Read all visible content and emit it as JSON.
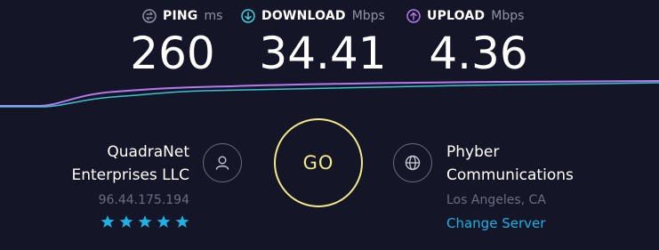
{
  "metrics": {
    "ping": {
      "label": "PING",
      "unit": "ms",
      "value": "260",
      "icon": "ping-icon",
      "color": "#9193a8"
    },
    "download": {
      "label": "DOWNLOAD",
      "unit": "Mbps",
      "value": "34.41",
      "icon": "download-icon",
      "color": "#3fd6e3"
    },
    "upload": {
      "label": "UPLOAD",
      "unit": "Mbps",
      "value": "4.36",
      "icon": "upload-icon",
      "color": "#b57af0"
    }
  },
  "isp": {
    "name_line1": "QuadraNet",
    "name_line2": "Enterprises LLC",
    "ip": "96.44.175.194",
    "rating": 5,
    "rating_max": 5,
    "icon": "user-icon"
  },
  "go_button": {
    "label": "GO",
    "color": "#f2ea8a"
  },
  "server": {
    "name_line1": "Phyber",
    "name_line2": "Communications",
    "location": "Los Angeles, CA",
    "change_label": "Change Server",
    "icon": "globe-icon"
  },
  "colors": {
    "background": "#141526",
    "link": "#1fb1e4",
    "star": "#1fb1e4"
  }
}
